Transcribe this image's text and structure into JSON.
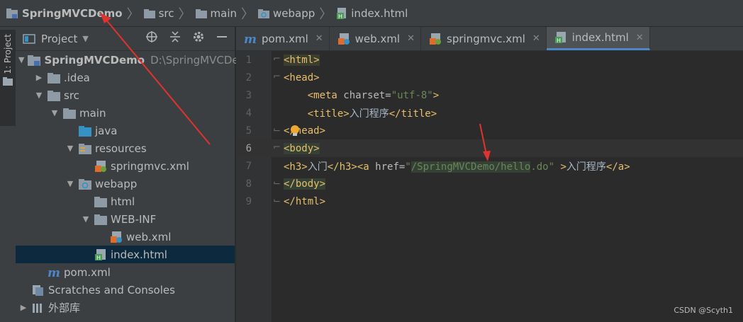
{
  "breadcrumb": {
    "items": [
      {
        "label": "SpringMVCDemo",
        "icon": "project-folder-icon"
      },
      {
        "label": "src",
        "icon": "folder-icon"
      },
      {
        "label": "main",
        "icon": "folder-icon"
      },
      {
        "label": "webapp",
        "icon": "web-folder-icon"
      },
      {
        "label": "index.html",
        "icon": "html-file-icon"
      }
    ]
  },
  "sidebar_strip": {
    "tab_label": "1: Project"
  },
  "project_panel": {
    "title": "Project",
    "tools": [
      "locate-icon",
      "collapse-icon",
      "gear-icon",
      "minimize-icon"
    ]
  },
  "tree": [
    {
      "label": "SpringMVCDemo",
      "path": "D:\\SpringMVCDe",
      "icon": "project-folder-icon",
      "expanded": true
    },
    {
      "label": ".idea",
      "icon": "folder-icon",
      "expanded": false
    },
    {
      "label": "src",
      "icon": "folder-icon",
      "expanded": true
    },
    {
      "label": "main",
      "icon": "folder-icon",
      "expanded": true
    },
    {
      "label": "java",
      "icon": "source-folder-icon"
    },
    {
      "label": "resources",
      "icon": "resources-folder-icon",
      "expanded": true
    },
    {
      "label": "springmvc.xml",
      "icon": "spring-xml-icon"
    },
    {
      "label": "webapp",
      "icon": "web-folder-icon",
      "expanded": true
    },
    {
      "label": "html",
      "icon": "folder-icon"
    },
    {
      "label": "WEB-INF",
      "icon": "folder-icon",
      "expanded": true
    },
    {
      "label": "web.xml",
      "icon": "web-xml-icon"
    },
    {
      "label": "index.html",
      "icon": "html-file-icon",
      "selected": true
    },
    {
      "label": "pom.xml",
      "icon": "maven-icon"
    },
    {
      "label": "Scratches and Consoles",
      "icon": "scratches-icon"
    },
    {
      "label": "外部库",
      "icon": "libraries-icon",
      "expanded": false
    }
  ],
  "tabs": [
    {
      "label": "pom.xml",
      "icon": "maven-icon",
      "active": false
    },
    {
      "label": "web.xml",
      "icon": "web-xml-icon",
      "active": false
    },
    {
      "label": "springmvc.xml",
      "icon": "spring-xml-icon",
      "active": false
    },
    {
      "label": "index.html",
      "icon": "html-file-icon",
      "active": true
    }
  ],
  "editor": {
    "current_line": 6,
    "lines": [
      {
        "n": "1",
        "text": "<html>"
      },
      {
        "n": "2",
        "text": "<head>"
      },
      {
        "n": "3",
        "text": "    <meta charset=\"utf-8\">"
      },
      {
        "n": "4",
        "text": "    <title>入门程序</title>"
      },
      {
        "n": "5",
        "text": "</head>"
      },
      {
        "n": "6",
        "text": "<body>"
      },
      {
        "n": "7",
        "text": "<h3>入门</h3><a href=\"/SpringMVCDemo/hello.do\" >入门程序</a>"
      },
      {
        "n": "8",
        "text": "</body>"
      },
      {
        "n": "9",
        "text": "</html>"
      }
    ]
  },
  "watermark": "CSDN @Scyth1",
  "colors": {
    "accent": "#4a88c7",
    "selection": "#0d293e",
    "annotation": "#e0332f"
  }
}
